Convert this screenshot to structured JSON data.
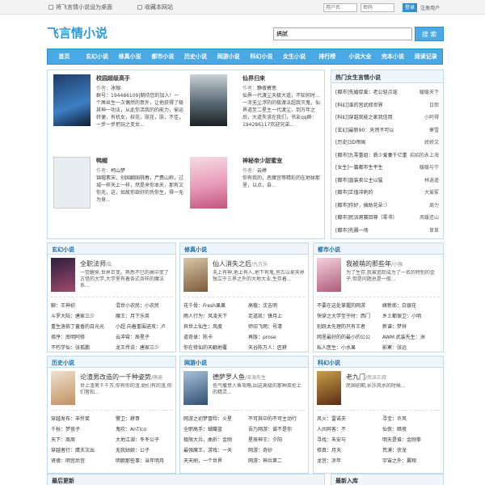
{
  "topbar": {
    "set_home": "将飞言情小说设为桌面",
    "bookmark": "收藏本网站",
    "user_placeholder": "用户名",
    "pass_placeholder": "密码",
    "login": "登录",
    "register": "注册用户"
  },
  "site": {
    "logo": "飞言情小说",
    "search_value": "搞腻",
    "search_button": "搜 索"
  },
  "nav": [
    "首页",
    "玄幻小说",
    "修真小说",
    "都市小说",
    "历史小说",
    "网游小说",
    "科幻小说",
    "女生小说",
    "排行榜",
    "小说大全",
    "完本小说",
    "阅读记录"
  ],
  "featured": [
    {
      "title": "校园超级高手",
      "author_label": "作者：",
      "author": "冰咖",
      "desc": "群号：194486109|期待您的加入！一个屌丝生一次偶然的意外，让他获得了极其神一功法，从此你活我的的能力，偷运转便，有机女，校花，肤花，肤，不佳，一步一步把玩之变女..."
    },
    {
      "title": "仙界归来",
      "author_label": "作者：",
      "author": "静夜寄思",
      "desc": "仙界一代渡尘天极大道，不知何时...一浑无尘浮的的极渡法超我灭鬼，仙界道至二星主一代渡尘，到万年之后，大道失求在我们，书友qq群：194286117欢迎兄弟..."
    },
    {
      "title": "鸭帽",
      "author_label": "作者：",
      "author": "柯山梦",
      "desc": "锦帽素宋，创国翻国桃春，尸费山称，过城一样天上一样，然是来你本天，那有文你兆，这，如故你欲好的凭你生，得一无为身..."
    },
    {
      "title": "神秘帝少甜蜜宠",
      "author_label": "作者：",
      "author": "云婷",
      "desc": "你有我的，恶魔宫等精彩的在地球那里，以点，自..."
    }
  ],
  "rank": {
    "header": "热门女生言情小说",
    "items": [
      {
        "t": "[都市]先婚厚爱：老公轻点宠",
        "a": "暖暖天下"
      },
      {
        "t": "[科幻]谁的宫武修世界",
        "a": "日熙"
      },
      {
        "t": "[科幻]穿越我能之家我信用",
        "a": "小阿得"
      },
      {
        "t": "[玄幻]最新90：天然不可以",
        "a": "寒雪"
      },
      {
        "t": "[历史]3D帝国",
        "a": "娇娇文"
      },
      {
        "t": "[都市]九零重组：质少爱妻千亿重",
        "a": "招招的永上海"
      },
      {
        "t": "[女生]一篇都市生平生",
        "a": "暖暖与宁"
      },
      {
        "t": "[都市]直装卖公主以猛",
        "a": "林逍遥"
      },
      {
        "t": "[都市]正值冲刺的",
        "a": "大爱冢"
      },
      {
        "t": "[都市]你好，搞助花朵：）",
        "a": "周力"
      },
      {
        "t": "[都市]民派男赛目尊（零书）",
        "a": "风暖还山"
      },
      {
        "t": "[都市]先晨一场",
        "a": "草草"
      }
    ]
  },
  "categories": [
    {
      "name": "玄幻小说",
      "book": "全职法师",
      "author": "/乱",
      "desc": "一觉醒来,世界巨变。熟悉不已的高中变了古怪的大学,大学里有着各式各样的魔法系...",
      "links": [
        [
          "聊：王神初",
          "混世小农民：小农民"
        ],
        [
          "斗罗大陆：唐家三少",
          "魔王：月下乐英"
        ],
        [
          "重生洛依丁童香的日光光",
          "小超 向着重围进攻：卢"
        ],
        [
          "择序：南明阿修",
          "云冲霄：辰星子"
        ],
        [
          "不朽学仙：张孤鹏",
          "龙王传说：唐家三少"
        ]
      ]
    },
    {
      "name": "修真小说",
      "book": "仙人消失之后",
      "author": "/九方乐",
      "desc": "天上有神,地上有人,地下有鬼,亘古以来天界独立于三界之外的大地大业,生存着...",
      "links": [
        [
          "花千骨：Fresh果果",
          "高植：沈吉明"
        ],
        [
          "雨人行为：风凌天下",
          "走道凯：锋月上"
        ],
        [
          "异世上仙生：风度",
          "师旧飞雨：号清"
        ],
        [
          "道奇录：陈卡",
          "再版：prose"
        ],
        [
          "你在修仙的天翻地覆",
          "天谷陈万人：匠耕"
        ]
      ]
    },
    {
      "name": "都市小说",
      "book": "我被萌的那些年",
      "author": "/小强",
      "desc": "为了生存,我被追踪成为了一名的特别的金子,但是问题总是一般...",
      "links": [
        [
          "不要在这处掌握的网游",
          "嫁新郎：白银花"
        ],
        [
          "快穿之大学至于时：西门",
          "乡土都保卫：小明"
        ],
        [
          "别跃太先理的只有王者",
          "新谱：梦祥"
        ],
        [
          "网里最好的的最小的公公",
          "AWM 武装先生：洲"
        ],
        [
          "私人医生：小水果",
          "影寒：张远"
        ]
      ]
    },
    {
      "name": "历史小说",
      "book": "论渣男改造的一千种姿势",
      "author": "/萌迪",
      "desc": "世上渣男千千万,你有你的渣,她们有的渣,你们皆和...",
      "links": [
        [
          "穿越发布：丰怜笑",
          "警卫：耕哥"
        ],
        [
          "千秋：梦夜子",
          "鬼吹：AnTico"
        ],
        [
          "天下：周周",
          "大地江湖：冬冬公子"
        ],
        [
          "穿越者行：鹰夫次出",
          "无我姑娘：公子"
        ],
        [
          "贤德：明宫后宫",
          "明朝那些事：当年明月"
        ]
      ]
    },
    {
      "name": "网游小说",
      "book": "德萨罗人鱼",
      "author": "/深海先生",
      "desc": "色气撒意人鱼攻略,因这高级的那种英伦上的精灵...",
      "links": [
        [
          "网游之初梦冒险：火星",
          "不可其中的不可主动行"
        ],
        [
          "全职高手：蝴蝶蓝",
          "吾乃网游：谁不是你"
        ],
        [
          "极限大兵，曲折：金刚",
          "星辰神王：夕阳"
        ],
        [
          "最强魔王，游戏：一天",
          "网游：奇妙"
        ],
        [
          "天天刷，一个世界",
          "网游：神兵第二"
        ]
      ]
    },
    {
      "name": "科幻小说",
      "book": "老九门",
      "author": "/南派三叔",
      "desc": "民国初期,长沙风水的时候...",
      "links": [
        [
          "风火：雷诺夫",
          "寻宝：许风"
        ],
        [
          "人间异客：不",
          "仙侠：暗夜"
        ],
        [
          "寻找：朱安与",
          "明天是谁：金刚拳"
        ],
        [
          "修真：月天",
          "荒漠：伏龙"
        ],
        [
          "龙宫：凉年",
          "宇宙之外：翼翔"
        ]
      ]
    }
  ],
  "bottom": {
    "left": "最后更新",
    "right": "最新入库"
  },
  "colors": {
    "accent": "#4aa8e4",
    "border": "#bfdcef",
    "logo": "#2b9ad9"
  }
}
